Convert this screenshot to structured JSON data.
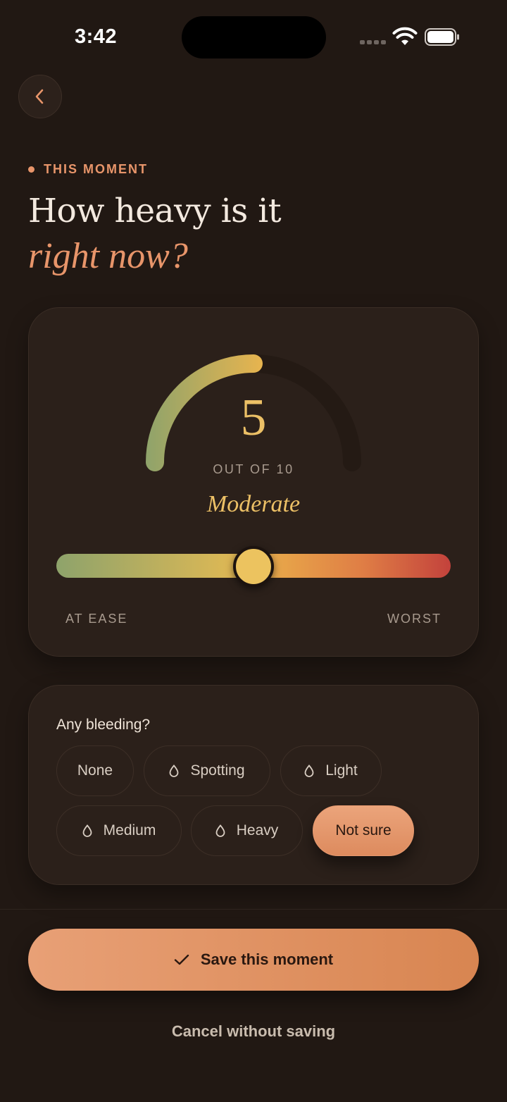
{
  "status_bar": {
    "time": "3:42"
  },
  "header": {
    "eyebrow": "THIS MOMENT",
    "title_line1": "How heavy is it",
    "title_line2": "right now?"
  },
  "intensity": {
    "score": "5",
    "out_of_label": "OUT OF 10",
    "severity_label": "Moderate",
    "value": 5,
    "max": 10,
    "min_label": "AT EASE",
    "max_label": "WORST"
  },
  "bleeding": {
    "question": "Any bleeding?",
    "options": [
      {
        "label": "None",
        "icon": "none",
        "selected": false
      },
      {
        "label": "Spotting",
        "icon": "drop-icon",
        "selected": false
      },
      {
        "label": "Light",
        "icon": "drop-icon",
        "selected": false
      },
      {
        "label": "Medium",
        "icon": "drop-icon",
        "selected": false
      },
      {
        "label": "Heavy",
        "icon": "drop-icon",
        "selected": false
      },
      {
        "label": "Not sure",
        "icon": "none",
        "selected": true
      }
    ]
  },
  "actions": {
    "save_label": "Save this moment",
    "cancel_label": "Cancel without saving"
  },
  "colors": {
    "background": "#211813",
    "card": "#2b201a",
    "accent": "#e8956a",
    "gold": "#ecc066",
    "scale_start": "#8ea36b",
    "scale_end": "#c3423c"
  }
}
